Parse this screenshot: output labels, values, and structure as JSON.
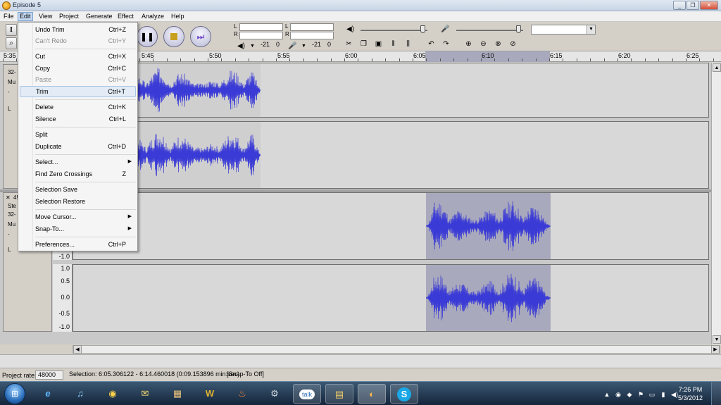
{
  "window": {
    "title": "Episode 5",
    "buttons": [
      "_",
      "❐",
      "✕"
    ]
  },
  "menubar": [
    "File",
    "Edit",
    "View",
    "Project",
    "Generate",
    "Effect",
    "Analyze",
    "Help"
  ],
  "edit_menu": {
    "items": [
      {
        "label": "Undo Trim",
        "shortcut": "Ctrl+Z",
        "enabled": true
      },
      {
        "label": "Can't Redo",
        "shortcut": "Ctrl+Y",
        "enabled": false
      },
      {
        "label": "Cut",
        "shortcut": "Ctrl+X",
        "enabled": true
      },
      {
        "label": "Copy",
        "shortcut": "Ctrl+C",
        "enabled": true
      },
      {
        "label": "Paste",
        "shortcut": "Ctrl+V",
        "enabled": false
      },
      {
        "label": "Trim",
        "shortcut": "Ctrl+T",
        "enabled": true,
        "highlighted": true
      },
      {
        "label": "Delete",
        "shortcut": "Ctrl+K",
        "enabled": true
      },
      {
        "label": "Silence",
        "shortcut": "Ctrl+L",
        "enabled": true
      },
      {
        "label": "Split",
        "shortcut": "",
        "enabled": true
      },
      {
        "label": "Duplicate",
        "shortcut": "Ctrl+D",
        "enabled": true
      },
      {
        "label": "Select...",
        "shortcut": "",
        "enabled": true,
        "submenu": true
      },
      {
        "label": "Find Zero Crossings",
        "shortcut": "Z",
        "enabled": true
      },
      {
        "label": "Selection Save",
        "shortcut": "",
        "enabled": true
      },
      {
        "label": "Selection Restore",
        "shortcut": "",
        "enabled": true
      },
      {
        "label": "Move Cursor...",
        "shortcut": "",
        "enabled": true,
        "submenu": true
      },
      {
        "label": "Snap-To...",
        "shortcut": "",
        "enabled": true,
        "submenu": true
      },
      {
        "label": "Preferences...",
        "shortcut": "Ctrl+P",
        "enabled": true
      }
    ]
  },
  "toolbar": {
    "meter_left_value": "-21",
    "meter_left_zero": "0",
    "meter_right_value": "-21",
    "meter_right_zero": "0",
    "channel_l": "L",
    "channel_r": "R"
  },
  "ruler": {
    "labels": [
      "5:35",
      "5:45",
      "5:50",
      "5:55",
      "6:00",
      "6:05",
      "6:10",
      "6:15",
      "6:20",
      "6:25"
    ]
  },
  "tracks": {
    "track1_info": [
      "32-",
      "Mu",
      "-",
      "L"
    ],
    "track2_info": [
      "✕",
      "4!",
      "Ste",
      "32-",
      "Mu",
      "-",
      "L"
    ],
    "scale": [
      "1.0",
      "0.5",
      "0.0",
      "-0.5",
      "-1.0"
    ],
    "scale_partial": "-1.0"
  },
  "status": {
    "project_rate_label": "Project rate:",
    "project_rate_value": "48000",
    "selection": "Selection: 6:05.306122 - 6:14.460018 (0:09.153896 min:sec)",
    "snap": "[Snap-To Off]"
  },
  "taskbar": {
    "apps": [
      {
        "name": "internet-explorer-icon",
        "glyph": "e"
      },
      {
        "name": "itunes-icon",
        "glyph": "♫"
      },
      {
        "name": "chrome-icon",
        "glyph": "◉"
      },
      {
        "name": "mail-icon",
        "glyph": "✉"
      },
      {
        "name": "folder-icon",
        "glyph": "▦"
      },
      {
        "name": "wow-icon",
        "glyph": "W"
      },
      {
        "name": "game-icon",
        "glyph": "♨"
      },
      {
        "name": "steam-icon",
        "glyph": "⚙"
      },
      {
        "name": "gtalk-icon",
        "glyph": "talk"
      },
      {
        "name": "explorer-icon",
        "glyph": "▤"
      },
      {
        "name": "audacity-icon",
        "glyph": "◐"
      },
      {
        "name": "skype-icon",
        "glyph": "S"
      }
    ],
    "time": "7:26 PM",
    "date": "5/3/2012"
  },
  "colors": {
    "waveform": "#3a3ad6",
    "selection": "#a9a9bd"
  }
}
